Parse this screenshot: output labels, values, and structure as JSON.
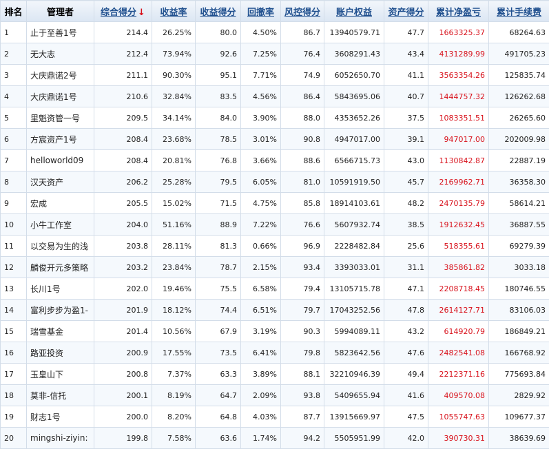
{
  "colors": {
    "header_text": "#1f4f8e",
    "header_bg": "#dbe6f3",
    "positive_pnl": "#d8111b",
    "border": "#d3dde9"
  },
  "header": {
    "rank": "排名",
    "manager": "管理者",
    "composite_score": "综合得分",
    "return_rate": "收益率",
    "return_score": "收益得分",
    "drawdown_rate": "回撤率",
    "risk_score": "风控得分",
    "account_equity": "账户权益",
    "asset_score": "资产得分",
    "cumulative_net_pnl": "累计净盈亏",
    "cumulative_fees": "累计手续费",
    "sort_icon": "down-arrow-icon"
  },
  "rows": [
    {
      "rank": "1",
      "manager": "止于至善1号",
      "composite": "214.4",
      "return_rate": "26.25%",
      "return_score": "80.0",
      "drawdown": "4.50%",
      "risk_score": "86.7",
      "equity": "13940579.71",
      "asset_score": "47.7",
      "net_pnl": "1663325.37",
      "fees": "68264.63"
    },
    {
      "rank": "2",
      "manager": "无大志",
      "composite": "212.4",
      "return_rate": "73.94%",
      "return_score": "92.6",
      "drawdown": "7.25%",
      "risk_score": "76.4",
      "equity": "3608291.43",
      "asset_score": "43.4",
      "net_pnl": "4131289.99",
      "fees": "491705.23"
    },
    {
      "rank": "3",
      "manager": "大庆鼎诺2号",
      "composite": "211.1",
      "return_rate": "90.30%",
      "return_score": "95.1",
      "drawdown": "7.71%",
      "risk_score": "74.9",
      "equity": "6052650.70",
      "asset_score": "41.1",
      "net_pnl": "3563354.26",
      "fees": "125835.74"
    },
    {
      "rank": "4",
      "manager": "大庆鼎诺1号",
      "composite": "210.6",
      "return_rate": "32.84%",
      "return_score": "83.5",
      "drawdown": "4.56%",
      "risk_score": "86.4",
      "equity": "5843695.06",
      "asset_score": "40.7",
      "net_pnl": "1444757.32",
      "fees": "126262.68"
    },
    {
      "rank": "5",
      "manager": "里魁资管一号",
      "composite": "209.5",
      "return_rate": "34.14%",
      "return_score": "84.0",
      "drawdown": "3.90%",
      "risk_score": "88.0",
      "equity": "4353652.26",
      "asset_score": "37.5",
      "net_pnl": "1083351.51",
      "fees": "26265.60"
    },
    {
      "rank": "6",
      "manager": "方宸资产1号",
      "composite": "208.4",
      "return_rate": "23.68%",
      "return_score": "78.5",
      "drawdown": "3.01%",
      "risk_score": "90.8",
      "equity": "4947017.00",
      "asset_score": "39.1",
      "net_pnl": "947017.00",
      "fees": "202009.98"
    },
    {
      "rank": "7",
      "manager": "helloworld09",
      "composite": "208.4",
      "return_rate": "20.81%",
      "return_score": "76.8",
      "drawdown": "3.66%",
      "risk_score": "88.6",
      "equity": "6566715.73",
      "asset_score": "43.0",
      "net_pnl": "1130842.87",
      "fees": "22887.19"
    },
    {
      "rank": "8",
      "manager": "汉天资产",
      "composite": "206.2",
      "return_rate": "25.28%",
      "return_score": "79.5",
      "drawdown": "6.05%",
      "risk_score": "81.0",
      "equity": "10591919.50",
      "asset_score": "45.7",
      "net_pnl": "2169962.71",
      "fees": "36358.30"
    },
    {
      "rank": "9",
      "manager": "宏成",
      "composite": "205.5",
      "return_rate": "15.02%",
      "return_score": "71.5",
      "drawdown": "4.75%",
      "risk_score": "85.8",
      "equity": "18914103.61",
      "asset_score": "48.2",
      "net_pnl": "2470135.79",
      "fees": "58614.21"
    },
    {
      "rank": "10",
      "manager": "小牛工作室",
      "composite": "204.0",
      "return_rate": "51.16%",
      "return_score": "88.9",
      "drawdown": "7.22%",
      "risk_score": "76.6",
      "equity": "5607932.74",
      "asset_score": "38.5",
      "net_pnl": "1912632.45",
      "fees": "36887.55"
    },
    {
      "rank": "11",
      "manager": "以交易为生的浅",
      "composite": "203.8",
      "return_rate": "28.11%",
      "return_score": "81.3",
      "drawdown": "0.66%",
      "risk_score": "96.9",
      "equity": "2228482.84",
      "asset_score": "25.6",
      "net_pnl": "518355.61",
      "fees": "69279.39"
    },
    {
      "rank": "12",
      "manager": "麟俊开元多策略",
      "composite": "203.2",
      "return_rate": "23.84%",
      "return_score": "78.7",
      "drawdown": "2.15%",
      "risk_score": "93.4",
      "equity": "3393033.01",
      "asset_score": "31.1",
      "net_pnl": "385861.82",
      "fees": "3033.18"
    },
    {
      "rank": "13",
      "manager": "长川1号",
      "composite": "202.0",
      "return_rate": "19.46%",
      "return_score": "75.5",
      "drawdown": "6.58%",
      "risk_score": "79.4",
      "equity": "13105715.78",
      "asset_score": "47.1",
      "net_pnl": "2208718.45",
      "fees": "180746.55"
    },
    {
      "rank": "14",
      "manager": "富利步步为盈1-",
      "composite": "201.9",
      "return_rate": "18.12%",
      "return_score": "74.4",
      "drawdown": "6.51%",
      "risk_score": "79.7",
      "equity": "17043252.56",
      "asset_score": "47.8",
      "net_pnl": "2614127.71",
      "fees": "83106.03"
    },
    {
      "rank": "15",
      "manager": "瑞雪基金",
      "composite": "201.4",
      "return_rate": "10.56%",
      "return_score": "67.9",
      "drawdown": "3.19%",
      "risk_score": "90.3",
      "equity": "5994089.11",
      "asset_score": "43.2",
      "net_pnl": "614920.79",
      "fees": "186849.21"
    },
    {
      "rank": "16",
      "manager": "路亚投资",
      "composite": "200.9",
      "return_rate": "17.55%",
      "return_score": "73.5",
      "drawdown": "6.41%",
      "risk_score": "79.8",
      "equity": "5823642.56",
      "asset_score": "47.6",
      "net_pnl": "2482541.08",
      "fees": "166768.92"
    },
    {
      "rank": "17",
      "manager": "玉皇山下",
      "composite": "200.8",
      "return_rate": "7.37%",
      "return_score": "63.3",
      "drawdown": "3.89%",
      "risk_score": "88.1",
      "equity": "32210946.39",
      "asset_score": "49.4",
      "net_pnl": "2212371.16",
      "fees": "775693.84"
    },
    {
      "rank": "18",
      "manager": "莫非-信托",
      "composite": "200.1",
      "return_rate": "8.19%",
      "return_score": "64.7",
      "drawdown": "2.09%",
      "risk_score": "93.8",
      "equity": "5409655.94",
      "asset_score": "41.6",
      "net_pnl": "409570.08",
      "fees": "2829.92"
    },
    {
      "rank": "19",
      "manager": "财志1号",
      "composite": "200.0",
      "return_rate": "8.20%",
      "return_score": "64.8",
      "drawdown": "4.03%",
      "risk_score": "87.7",
      "equity": "13915669.97",
      "asset_score": "47.5",
      "net_pnl": "1055747.63",
      "fees": "109677.37"
    },
    {
      "rank": "20",
      "manager": "mingshi-ziyin:",
      "composite": "199.8",
      "return_rate": "7.58%",
      "return_score": "63.6",
      "drawdown": "1.74%",
      "risk_score": "94.2",
      "equity": "5505951.99",
      "asset_score": "42.0",
      "net_pnl": "390730.31",
      "fees": "38639.69"
    }
  ]
}
